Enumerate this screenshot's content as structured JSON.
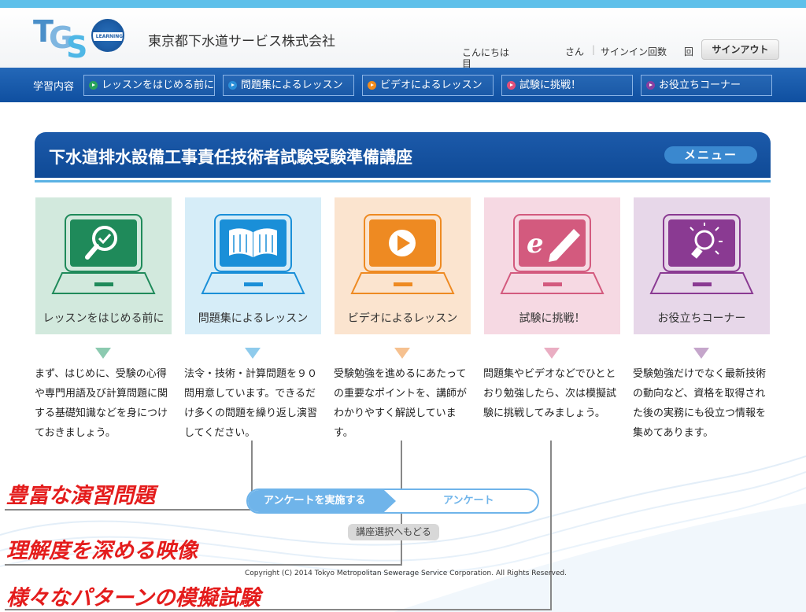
{
  "header": {
    "company_name": "東京都下水道サービス株式会社",
    "logo_text_learning": "LEARNING",
    "greeting_line1": "こんにちは",
    "greeting_line2": "目",
    "san": "さん",
    "separator": "|",
    "signin_count_label": "サインイン回数",
    "count_suffix": "回",
    "signout_label": "サインアウト"
  },
  "nav": {
    "label": "学習内容",
    "items": [
      {
        "label": "レッスンをはじめる前に",
        "color": "#2aa35a"
      },
      {
        "label": "問題集によるレッスン",
        "color": "#2b8fd8"
      },
      {
        "label": "ビデオによるレッスン",
        "color": "#f08c1e"
      },
      {
        "label": "試験に挑戦！",
        "color": "#e0507a"
      },
      {
        "label": "お役立ちコーナー",
        "color": "#8a3fa0"
      }
    ]
  },
  "main": {
    "title": "下水道排水設備工事責任技術者試験受験準備講座",
    "menu_label": "メニュー"
  },
  "cards": [
    {
      "label": "レッスンをはじめる前に",
      "icon": "magnifier-check-icon",
      "bg": "#d2e9dd",
      "accent": "#1f8a5a",
      "desc": "まず、はじめに、受験の心得や専門用語及び計算問題に関する基礎知識などを身につけておきましょう。"
    },
    {
      "label": "問題集によるレッスン",
      "icon": "open-book-icon",
      "bg": "#d6edf8",
      "accent": "#1a8fd8",
      "desc": "法令・技術・計算問題を９０問用意しています。できるだけ多くの問題を繰り返し演習してください。"
    },
    {
      "label": "ビデオによるレッスン",
      "icon": "play-video-icon",
      "bg": "#fbe4cf",
      "accent": "#ee8a22",
      "desc": "受験勉強を進めるにあたっての重要なポイントを、講師がわかりやすく解説しています。"
    },
    {
      "label": "試験に挑戦！",
      "icon": "exam-pencil-icon",
      "bg": "#f6d9e3",
      "accent": "#d35a7e",
      "desc": "問題集やビデオなどでひととおり勉強したら、次は模擬試験に挑戦してみましょう。"
    },
    {
      "label": "お役立ちコーナー",
      "icon": "lightbulb-icon",
      "bg": "#e7d7e9",
      "accent": "#8a3a92",
      "desc": "受験勉強だけでなく最新技術の動向など、資格を取得された後の実務にも役立つ情報を集めてあります。"
    }
  ],
  "annotations": [
    "豊富な演習問題",
    "理解度を深める映像",
    "様々なパターンの模擬試験"
  ],
  "survey": {
    "left_label": "アンケートを実施する",
    "right_label": "アンケート"
  },
  "back_label": "講座選択へもどる",
  "copyright": "Copyright (C) 2014 Tokyo Metropolitan Sewerage Service Corporation. All Rights Reserved."
}
